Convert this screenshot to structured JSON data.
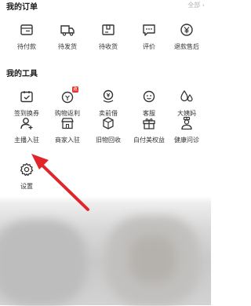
{
  "orders": {
    "title": "我的订单",
    "all_label": "全部 ›",
    "items": [
      {
        "label": "待付款",
        "icon": "wallet-icon"
      },
      {
        "label": "待发货",
        "icon": "truck-icon"
      },
      {
        "label": "待收货",
        "icon": "package-icon"
      },
      {
        "label": "评价",
        "icon": "comment-icon"
      },
      {
        "label": "退款售后",
        "icon": "refund-icon"
      }
    ]
  },
  "tools": {
    "title": "我的工具",
    "rows": [
      [
        {
          "label": "签到换券",
          "icon": "calendar-check-icon"
        },
        {
          "label": "购物返利",
          "icon": "rebate-icon",
          "badge": "返"
        },
        {
          "label": "卖前借",
          "icon": "coin-icon"
        },
        {
          "label": "客服",
          "icon": "support-icon"
        },
        {
          "label": "大姨妈",
          "icon": "drops-icon"
        }
      ],
      [
        {
          "label": "主播入驻",
          "icon": "anchor-user-icon"
        },
        {
          "label": "商家入驻",
          "icon": "store-icon"
        },
        {
          "label": "旧物回收",
          "icon": "recycle-box-icon"
        },
        {
          "label": "白付美权益",
          "icon": "gift-icon"
        },
        {
          "label": "健康问诊",
          "icon": "doctor-icon"
        }
      ],
      [
        {
          "label": "设置",
          "icon": "gear-icon"
        }
      ]
    ]
  },
  "colors": {
    "arrow": "#e0262a",
    "badge": "#e5302c"
  }
}
